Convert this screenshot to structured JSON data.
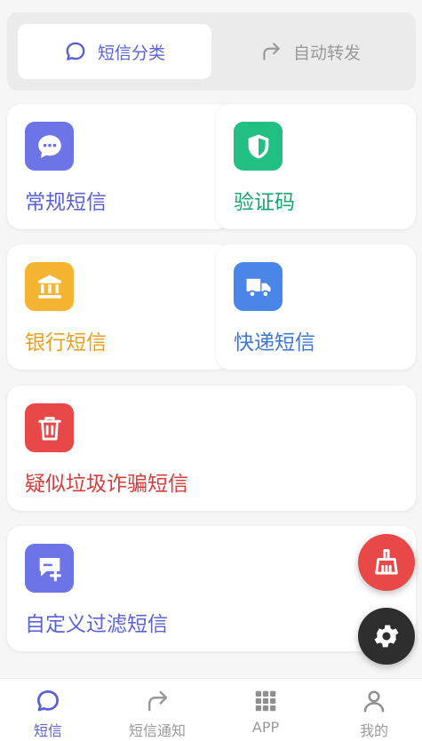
{
  "tabs": {
    "active": {
      "label": "短信分类",
      "icon": "chat-bubble-icon"
    },
    "inactive": {
      "label": "自动转发",
      "icon": "forward-arrow-icon"
    }
  },
  "cards": {
    "normal": {
      "label": "常规短信",
      "icon": "message-dots-icon",
      "color": "#5b62d4",
      "icon_bg": "#6d74e6"
    },
    "verify": {
      "label": "验证码",
      "icon": "shield-icon",
      "color": "#1aa671",
      "icon_bg": "#22bf83"
    },
    "bank": {
      "label": "银行短信",
      "icon": "bank-icon",
      "color": "#e8a020",
      "icon_bg": "#f5b431"
    },
    "express": {
      "label": "快递短信",
      "icon": "truck-icon",
      "color": "#3f77d4",
      "icon_bg": "#4a86e8"
    },
    "spam": {
      "label": "疑似垃圾诈骗短信",
      "icon": "trash-icon",
      "color": "#d63c3c",
      "icon_bg": "#e84848"
    },
    "custom": {
      "label": "自定义过滤短信",
      "icon": "add-message-icon",
      "color": "#5b62d4",
      "icon_bg": "#6d74e6"
    }
  },
  "fabs": {
    "clean": {
      "icon": "broom-icon",
      "color": "#e84848"
    },
    "settings": {
      "icon": "gear-icon",
      "color": "#2e2e2e"
    }
  },
  "nav": {
    "sms": {
      "label": "短信",
      "icon": "chat-bubble-icon",
      "color": "#5b62d4"
    },
    "notify": {
      "label": "短信通知",
      "icon": "forward-arrow-icon",
      "color": "#9a9a9a"
    },
    "app": {
      "label": "APP",
      "icon": "grid-icon",
      "color": "#9a9a9a"
    },
    "me": {
      "label": "我的",
      "icon": "person-icon",
      "color": "#9a9a9a"
    }
  }
}
